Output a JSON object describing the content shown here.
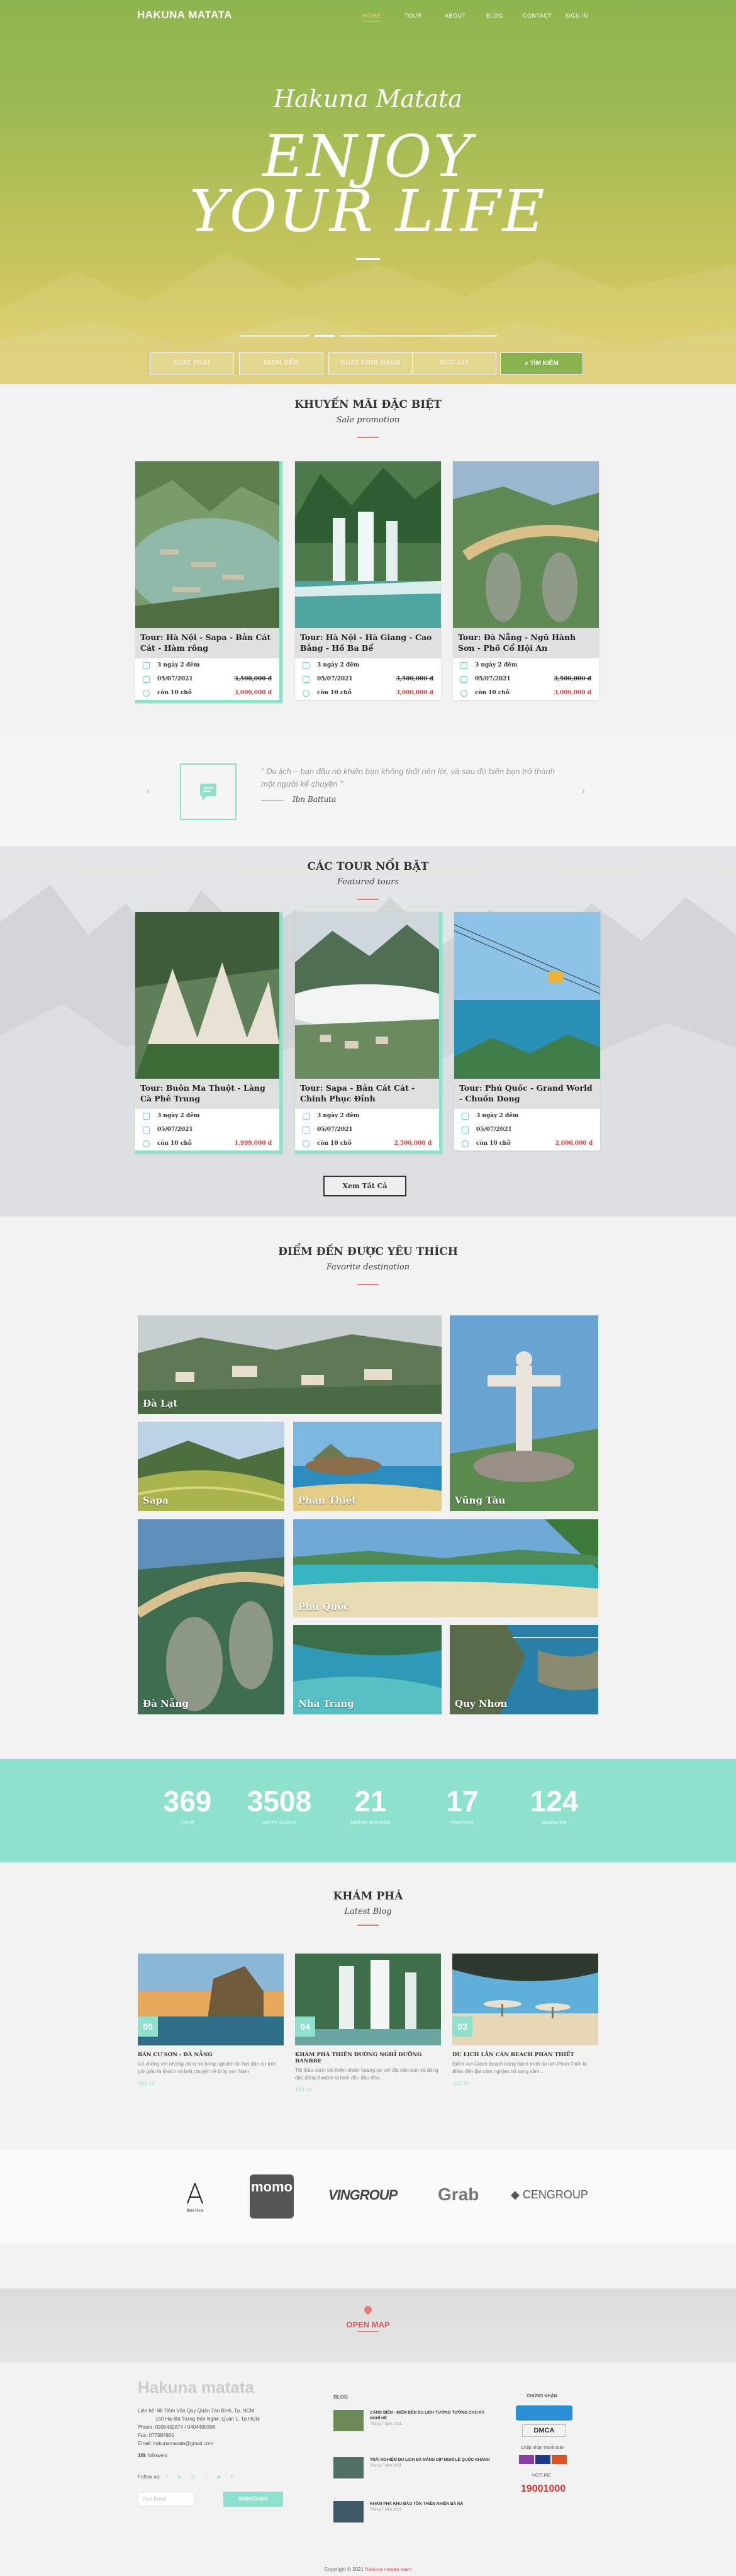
{
  "nav": {
    "brand": "HAKUNA MATATA",
    "items": [
      "HOME",
      "TOUR",
      "ABOUT",
      "BLOG",
      "CONTACT",
      "SIGN IN"
    ]
  },
  "hero": {
    "script": "Hakuna Matata",
    "line1": "ENJOY",
    "line2": "YOUR LIFE",
    "filters": [
      "XUẤT PHÁT",
      "ĐIỂM ĐẾN",
      "NGÀY KHỞI HÀNH",
      "MỨC GIÁ"
    ],
    "search": "TÌM KIẾM"
  },
  "promo": {
    "title": "KHUYẾN MÃI ĐẶC BIỆT",
    "subtitle": "Sale promotion",
    "cards": [
      {
        "title": "Tour: Hà Nội - Sapa - Bản Cát Cát - Hàm rồng",
        "duration": "3 ngày 2 đêm",
        "date": "05/07/2021",
        "seats": "còn 10 chỗ",
        "old_price": "3,500,000 đ",
        "new_price": "3,000,000 đ"
      },
      {
        "title": "Tour: Hà Nội - Hà Giang - Cao Bằng - Hồ Ba Bể",
        "duration": "3 ngày 2 đêm",
        "date": "05/07/2021",
        "seats": "còn 10 chỗ",
        "old_price": "3,500,000 đ",
        "new_price": "3,000,000 đ"
      },
      {
        "title": "Tour: Đà Nẵng - Ngũ Hành Sơn - Phố Cổ Hội An",
        "duration": "3 ngày 2 đêm",
        "date": "05/07/2021",
        "seats": "còn 10 chỗ",
        "old_price": "3,500,000 đ",
        "new_price": "3,000,000 đ"
      }
    ]
  },
  "quote": {
    "text": "\" Du lịch – ban đầu nó khiến bạn không thốt nên lời, và sau đó biến bạn trở thành một người kể chuyện \"",
    "author": "Ibn Battuta"
  },
  "featured": {
    "title": "CÁC TOUR NỔI BẬT",
    "subtitle": "Featured tours",
    "button": "Xem Tất Cả",
    "cards": [
      {
        "title": "Tour: Buôn Ma Thuột - Làng Cà Phê Trung",
        "duration": "3 ngày 2 đêm",
        "date": "05/07/2021",
        "seats": "còn 10 chỗ",
        "price": "1,999,000 đ"
      },
      {
        "title": "Tour: Sapa - Bản Cát Cát - Chinh Phục Đỉnh",
        "duration": "3 ngày 2 đêm",
        "date": "05/07/2021",
        "seats": "còn 10 chỗ",
        "price": "2,500,000 đ"
      },
      {
        "title": "Tour: Phú Quốc - Grand World - Chuồn Dong",
        "duration": "3 ngày 2 đêm",
        "date": "05/07/2021",
        "seats": "còn 10 chỗ",
        "price": "2,000,000 đ"
      }
    ]
  },
  "destinations": {
    "title": "ĐIỂM ĐẾN ĐƯỢC YÊU THÍCH",
    "subtitle": "Favorite destination",
    "items": [
      "Đà Lạt",
      "Vũng Tàu",
      "Sapa",
      "Phan Thiết",
      "Đà Nẵng",
      "Phú Quốc",
      "Nha Trang",
      "Quy Nhơn"
    ]
  },
  "stats": [
    {
      "n": "369",
      "l": "TOUR"
    },
    {
      "n": "3508",
      "l": "HAPPY CLIENT"
    },
    {
      "n": "21",
      "l": "AWARD WINNING"
    },
    {
      "n": "17",
      "l": "PARTNER"
    },
    {
      "n": "124",
      "l": "MEMBERS"
    }
  ],
  "blog": {
    "title": "KHÁM PHÁ",
    "subtitle": "Latest Blog",
    "posts": [
      {
        "num": "05",
        "title": "BÁN CƯ SƠN - ĐÀ NẴNG",
        "desc": "Có chồng với những chứa và bóng nghiêm tín hợi dân cư trên giờ giấu là khách và biết chuyện về thùy vạn Nam",
        "meta": "10/1   10"
      },
      {
        "num": "04",
        "title": "KHÁM PHÁ THIÊN ĐƯỜNG NGHỈ DƯỠNG BANBRE",
        "desc": "Tôi thấu cảnh vật thiên nhiên hoang sơ với địa trên tròn và dòng đặc đông Banbre là hinh đều đầu đều...",
        "meta": "10/1   10"
      },
      {
        "num": "03",
        "title": "DU LỊCH LÂN CÁN BEACH PHAN THIẾT",
        "desc": "Điểm vựt Gieco Beach trang hành trình du lịch Phan Thiết là điểm đến đạt cảm nghệm bổ sung sắm...",
        "meta": "10/1   10"
      }
    ]
  },
  "partners": [
    "Bela Vista",
    "momo",
    "VINGROUP",
    "Grab",
    "CENGROUP"
  ],
  "map": {
    "label": "OPEN MAP"
  },
  "footer": {
    "brand": "Hakuna matata",
    "address_label": "Liên hệ:",
    "address": "88 Tiệm Vân Quy Quận Tân Bình, Tp. HCM",
    "address2": "150 Hai Bà Trưng Bến Nghé, Quận 1, Tp HCM",
    "phone": "Phone: 0905432874 / 0404499306",
    "fax": "Fax: 077084800",
    "email": "Email: hakunamatata@gmail.com",
    "followers_label": "10k",
    "followers_suffix": "followers",
    "follow": "Follow us:",
    "subscribe_ph": "Your Email",
    "subscribe_btn": "SUBSCRIBE",
    "blog_heading": "BLOG",
    "blog_items": [
      {
        "t": "CẢNG BIỂN - ĐIỂM ĐẾN DU LỊCH TƯƠNG TƯỞNG CHO KỲ NGHỈ HÈ",
        "d": "Tháng 7 năm 2021"
      },
      {
        "t": "TRẢI NGHIỆM DU LỊCH ĐÀ NẴNG DỊP NGHỈ LỄ QUỐC KHÁNH",
        "d": "Tháng 7 năm 2021"
      },
      {
        "t": "KHÁM PHÁ KHU BẢO TỒN THIÊN NHIÊN BÀ NÀ",
        "d": "Tháng 7 năm 2021"
      }
    ],
    "cert_heading": "CHỨNG NHẬN",
    "dmca": "DMCA",
    "pay_heading": "Chấp nhận thanh toán",
    "hotline_heading": "HOTLINE",
    "hotline": "19001000",
    "copyright": "Copyright © 2021",
    "copyright_brand": "Hakuna matata team"
  }
}
